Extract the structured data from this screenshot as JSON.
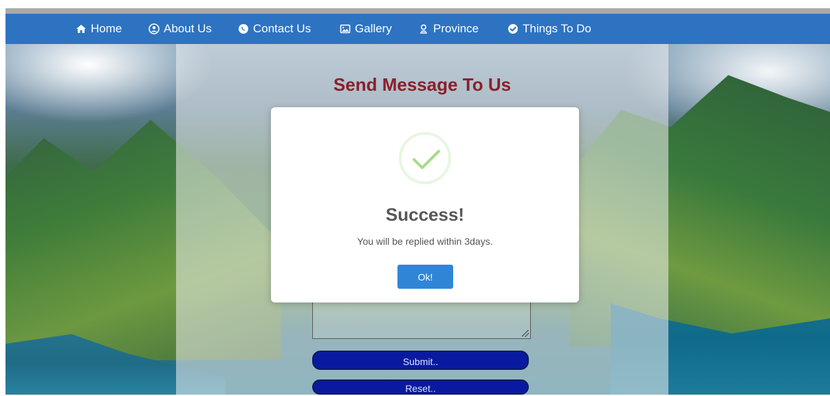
{
  "nav": {
    "items": [
      {
        "label": "Home",
        "icon": "home-icon"
      },
      {
        "label": "About Us",
        "icon": "user-circle-icon"
      },
      {
        "label": "Contact Us",
        "icon": "phone-icon"
      },
      {
        "label": "Gallery",
        "icon": "image-icon"
      },
      {
        "label": "Province",
        "icon": "map-pin-icon"
      },
      {
        "label": "Things To Do",
        "icon": "check-circle-icon"
      }
    ]
  },
  "page": {
    "title": "Send Message To Us",
    "submit_label": "Submit..",
    "reset_label": "Reset.."
  },
  "modal": {
    "title": "Success!",
    "text": "You will be replied within 3days.",
    "ok_label": "Ok!"
  },
  "colors": {
    "nav_blue": "#2d73c2",
    "title_red": "#8b1f2b",
    "ok_blue": "#3085d6",
    "success_green": "#a5dc86",
    "button_blue": "#0a1aa0"
  }
}
